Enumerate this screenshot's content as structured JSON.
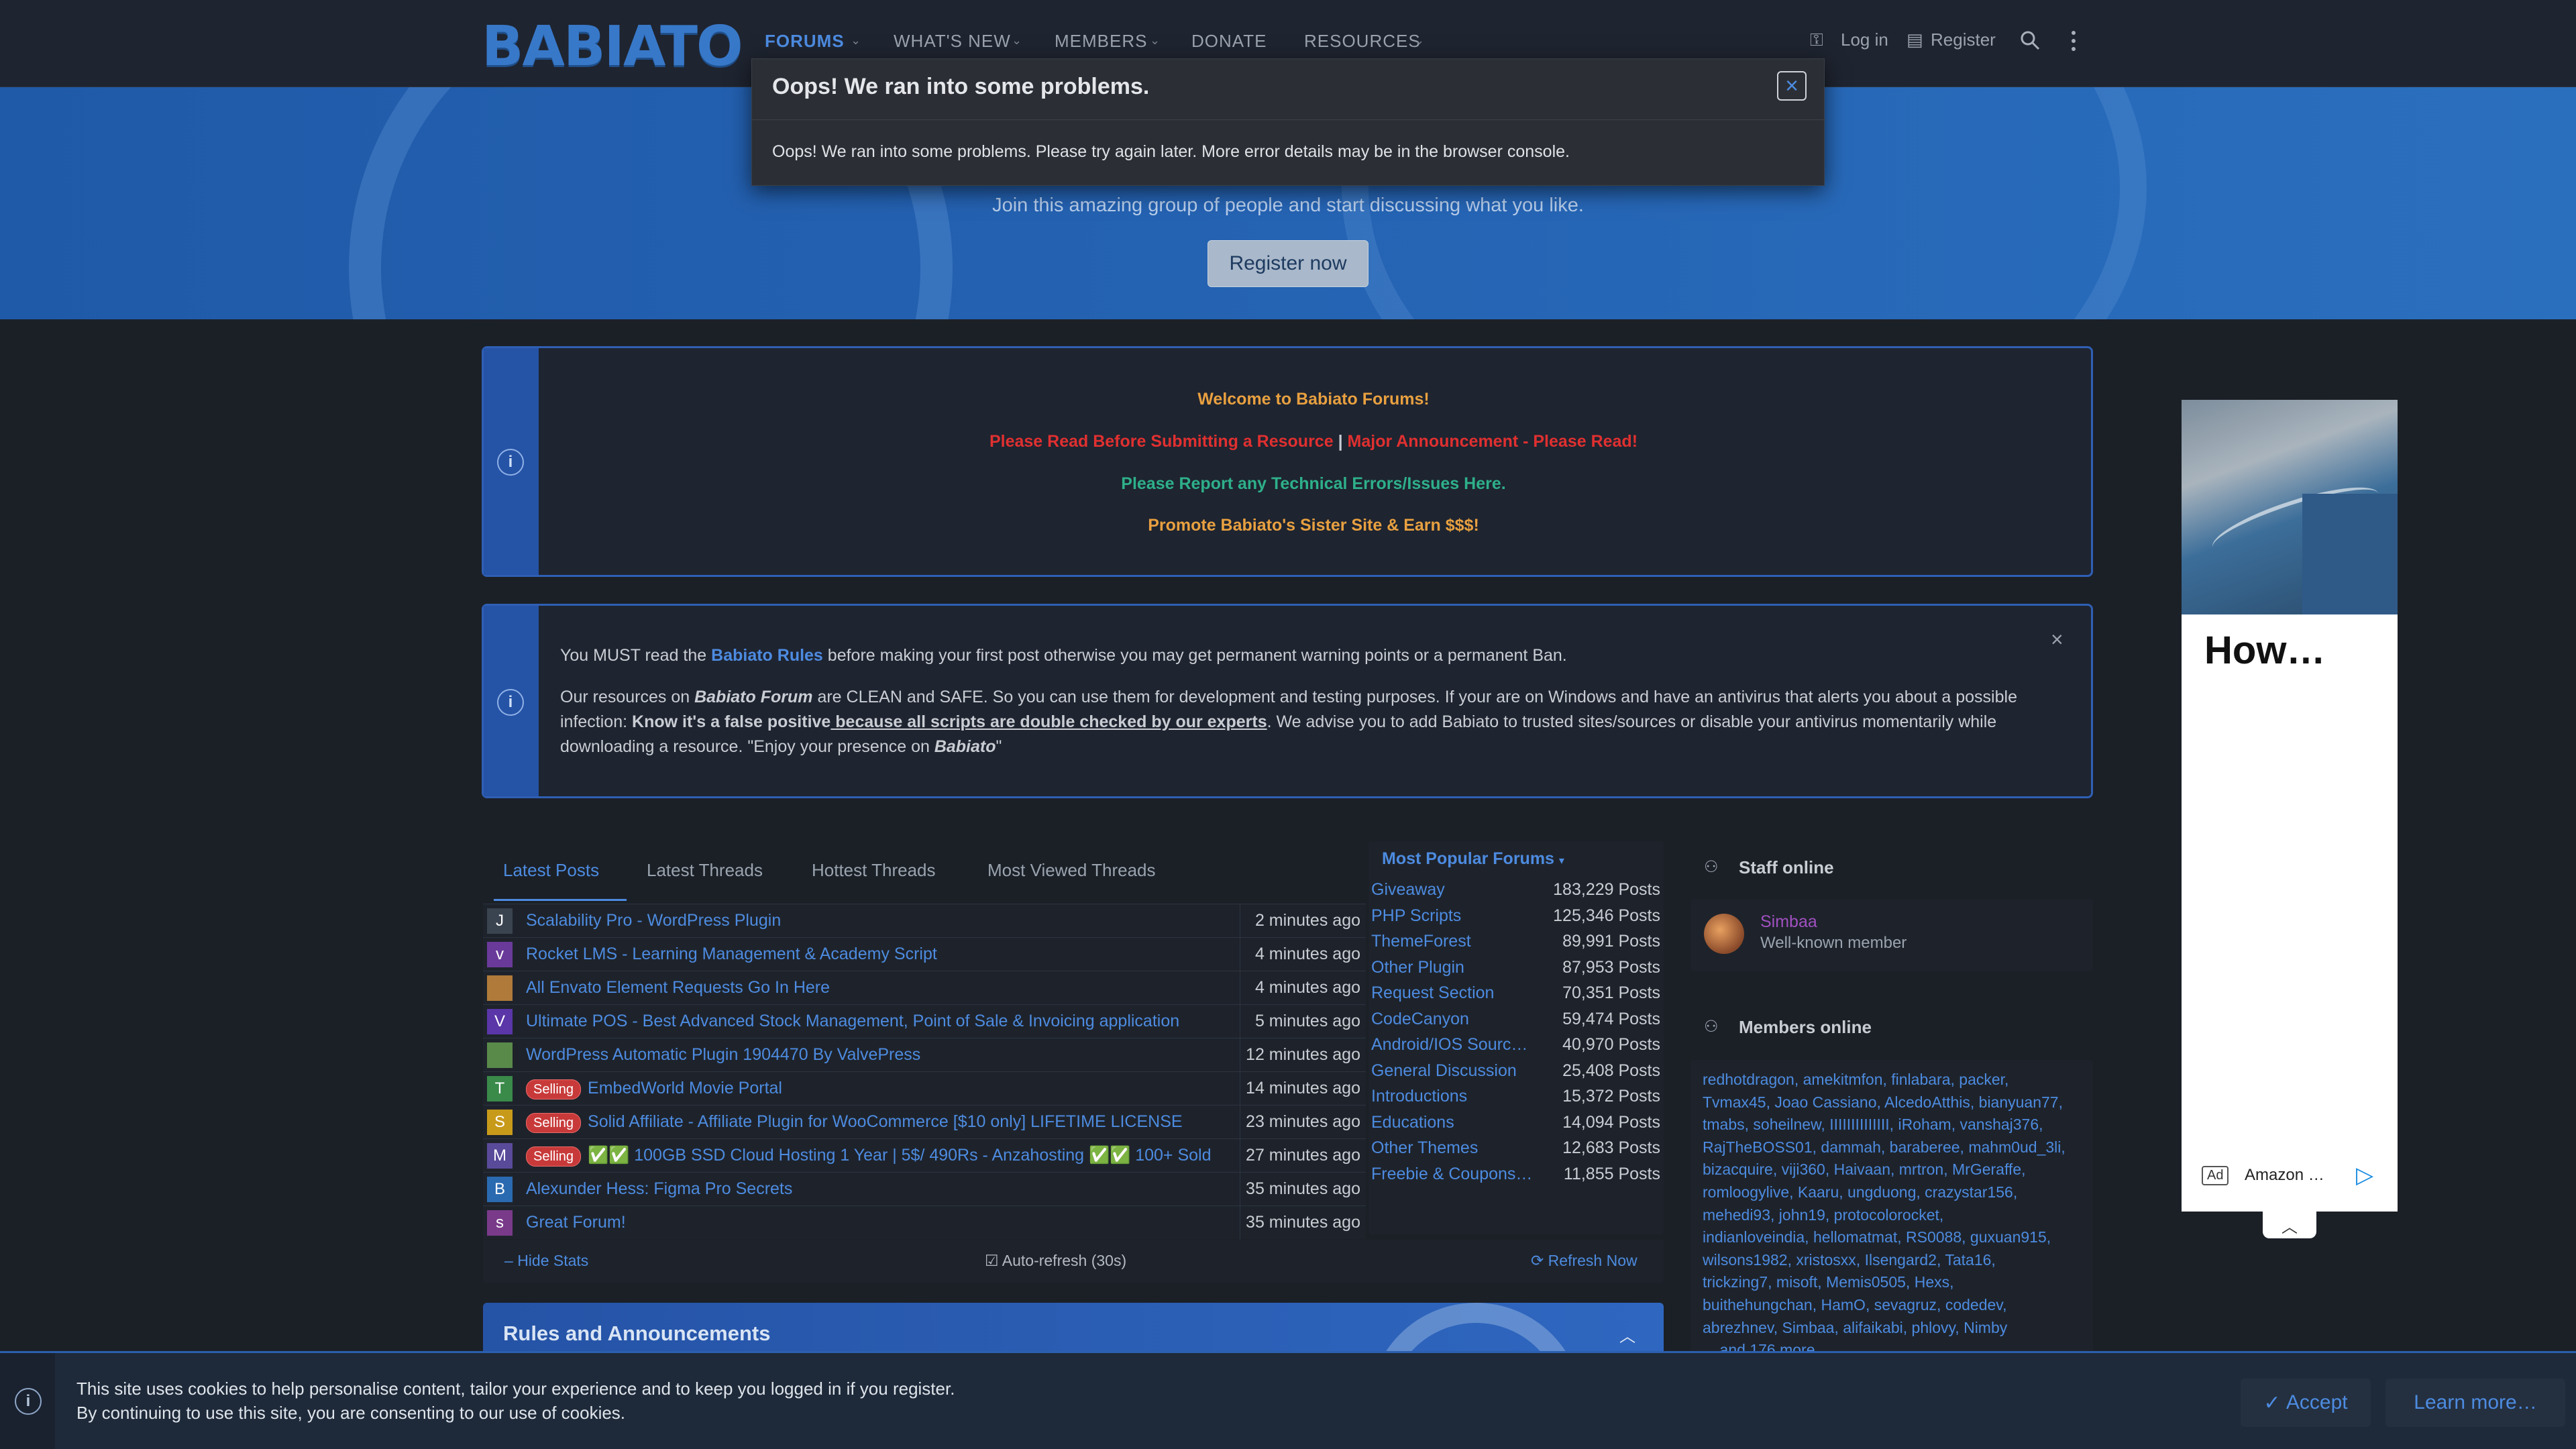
{
  "header": {
    "logo": "BABIATO",
    "nav": [
      {
        "label": "FORUMS"
      },
      {
        "label": "WHAT'S NEW"
      },
      {
        "label": "MEMBERS"
      },
      {
        "label": "DONATE"
      },
      {
        "label": "RESOURCES"
      }
    ],
    "login": "Log in",
    "register": "Register"
  },
  "hero": {
    "subtitle": "Join this amazing group of people and start discussing what you like.",
    "button": "Register now"
  },
  "modal": {
    "title": "Oops! We ran into some problems.",
    "body": "Oops! We ran into some problems. Please try again later. More error details may be in the browser console.",
    "close": "×"
  },
  "notice1": {
    "welcome": "Welcome to Babiato Forums!",
    "read": "Please Read Before Submitting a Resource",
    "sep": "|",
    "major": "Major Announcement - Please Read!",
    "report": "Please Report any Technical Errors/Issues Here.",
    "promote": "Promote Babiato's Sister Site & Earn $$$!"
  },
  "notice2": {
    "p1a": "You MUST read the ",
    "p1link": "Babiato Rules",
    "p1b": " before making your first post otherwise you may get permanent warning points or a permanent Ban.",
    "p2a": "Our resources on ",
    "p2b": "Babiato Forum",
    "p2c": " are CLEAN and SAFE. So you can use them for development and testing purposes. If your are on Windows and have an antivirus that alerts you about a possible infection: ",
    "p2d": "Know it's a false positive",
    "p2e": " because all scripts are double checked by our experts",
    "p2f": ". We advise you to add Babiato to trusted sites/sources or disable your antivirus momentarily while downloading a resource. \"Enjoy your presence on ",
    "p2g": "Babiato",
    "p2h": "\""
  },
  "tabs": [
    "Latest Posts",
    "Latest Threads",
    "Hottest Threads",
    "Most Viewed Threads"
  ],
  "posts": [
    {
      "av": "J",
      "color": "#3a4350",
      "title": "Scalability Pro - WordPress Plugin",
      "time": "2 minutes ago",
      "badge": ""
    },
    {
      "av": "v",
      "color": "#6a3a9a",
      "title": "Rocket LMS - Learning Management & Academy Script",
      "time": "4 minutes ago",
      "badge": ""
    },
    {
      "av": "",
      "color": "#b07a3a",
      "title": "All Envato Element Requests Go In Here",
      "time": "4 minutes ago",
      "badge": ""
    },
    {
      "av": "V",
      "color": "#5a36a8",
      "title": "Ultimate POS - Best Advanced Stock Management, Point of Sale & Invoicing application",
      "time": "5 minutes ago",
      "badge": ""
    },
    {
      "av": "",
      "color": "#5a8a4a",
      "title": "WordPress Automatic Plugin 1904470 By ValvePress",
      "time": "12 minutes ago",
      "badge": ""
    },
    {
      "av": "T",
      "color": "#3a8a4a",
      "title": "EmbedWorld Movie Portal",
      "time": "14 minutes ago",
      "badge": "Selling"
    },
    {
      "av": "S",
      "color": "#c89a1a",
      "title": "Solid Affiliate - Affiliate Plugin for WooCommerce [$10 only] LIFETIME LICENSE",
      "time": "23 minutes ago",
      "badge": "Selling"
    },
    {
      "av": "M",
      "color": "#5a4a9a",
      "title": "✅✅ 100GB SSD Cloud Hosting 1 Year | 5$/ 490Rs - Anzahosting ✅✅ 100+ Sold",
      "time": "27 minutes ago",
      "badge": "Selling"
    },
    {
      "av": "B",
      "color": "#2a6ab0",
      "title": "Alexunder Hess: Figma Pro Secrets",
      "time": "35 minutes ago",
      "badge": ""
    },
    {
      "av": "s",
      "color": "#7a3a8a",
      "title": "Great Forum!",
      "time": "35 minutes ago",
      "badge": ""
    }
  ],
  "popular": {
    "header": "Most Popular Forums",
    "items": [
      {
        "name": "Giveaway",
        "posts": "183,229 Posts"
      },
      {
        "name": "PHP Scripts",
        "posts": "125,346 Posts"
      },
      {
        "name": "ThemeForest",
        "posts": "89,991 Posts"
      },
      {
        "name": "Other Plugin",
        "posts": "87,953 Posts"
      },
      {
        "name": "Request Section",
        "posts": "70,351 Posts"
      },
      {
        "name": "CodeCanyon",
        "posts": "59,474 Posts"
      },
      {
        "name": "Android/IOS Sourc…",
        "posts": "40,970 Posts"
      },
      {
        "name": "General Discussion",
        "posts": "25,408 Posts"
      },
      {
        "name": "Introductions",
        "posts": "15,372 Posts"
      },
      {
        "name": "Educations",
        "posts": "14,094 Posts"
      },
      {
        "name": "Other Themes",
        "posts": "12,683 Posts"
      },
      {
        "name": "Freebie & Coupons…",
        "posts": "11,855 Posts"
      }
    ]
  },
  "stats_footer": {
    "hide": "Hide Stats",
    "auto": "Auto-refresh (30s)",
    "refresh": "Refresh Now"
  },
  "rules": {
    "title": "Rules and Announcements"
  },
  "staff": {
    "title": "Staff online",
    "name": "Simbaa",
    "role": "Well-known member"
  },
  "members": {
    "title": "Members online",
    "lines": [
      "redhotdragon, amekitmfon, finlabara, packer,",
      "Tvmax45, Joao Cassiano, AlcedoAtthis, bianyuan77,",
      "tmabs, soheilnew, IIIIIIIIIIIIII, iRoham, vanshaj376,",
      "RajTheBOSS01, dammah, baraberee, mahm0ud_3li,",
      "bizacquire, viji360, Haivaan, mrtron, MrGeraffe,",
      "romloogylive, Kaaru, ungduong, crazystar156,",
      "mehedi93, john19, protocolorocket,",
      "indianloveindia, hellomatmat, RS0088, guxuan915,",
      "wilsons1982, xristosxx, Ilsengard2, Tata16,",
      "trickzing7, misoft, Memis0505, Hexs,",
      "buithehungchan, HamO, sevagruz, codedev,",
      "abrezhnev, Simbaa, alifaikabi, phlovy, Nimby",
      "... and 176 more."
    ]
  },
  "ad": {
    "headline": "How…",
    "label": "Ad",
    "brand": "Amazon …"
  },
  "cookie": {
    "line1": "This site uses cookies to help personalise content, tailor your experience and to keep you logged in if you register.",
    "line2": "By continuing to use this site, you are consenting to our use of cookies.",
    "accept": "Accept",
    "learn": "Learn more…"
  },
  "colors": {
    "accent": "#4d8be0",
    "orange": "#e8a040",
    "red": "#e03030",
    "green": "#2eb08a",
    "selling": "#c83a3a"
  }
}
